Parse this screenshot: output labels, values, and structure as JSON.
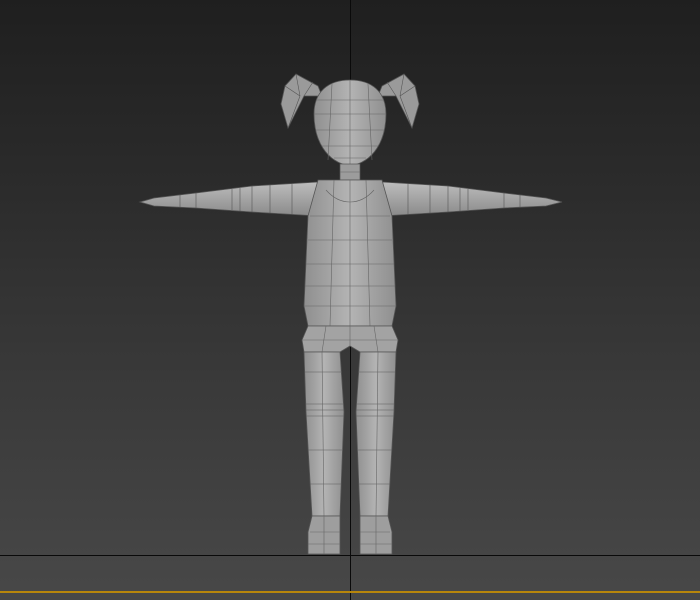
{
  "viewport": {
    "background_top": "#1f1f1f",
    "background_bottom": "#484848",
    "axis_color": "#0a0a0a",
    "border_color": "#b8860b",
    "mesh_fill": "#a6a6a6",
    "mesh_shade": "#8c8c8c",
    "mesh_wire": "#5a5a5a"
  },
  "model": {
    "icon": "character-mesh",
    "pose": "t-pose",
    "view": "front"
  }
}
